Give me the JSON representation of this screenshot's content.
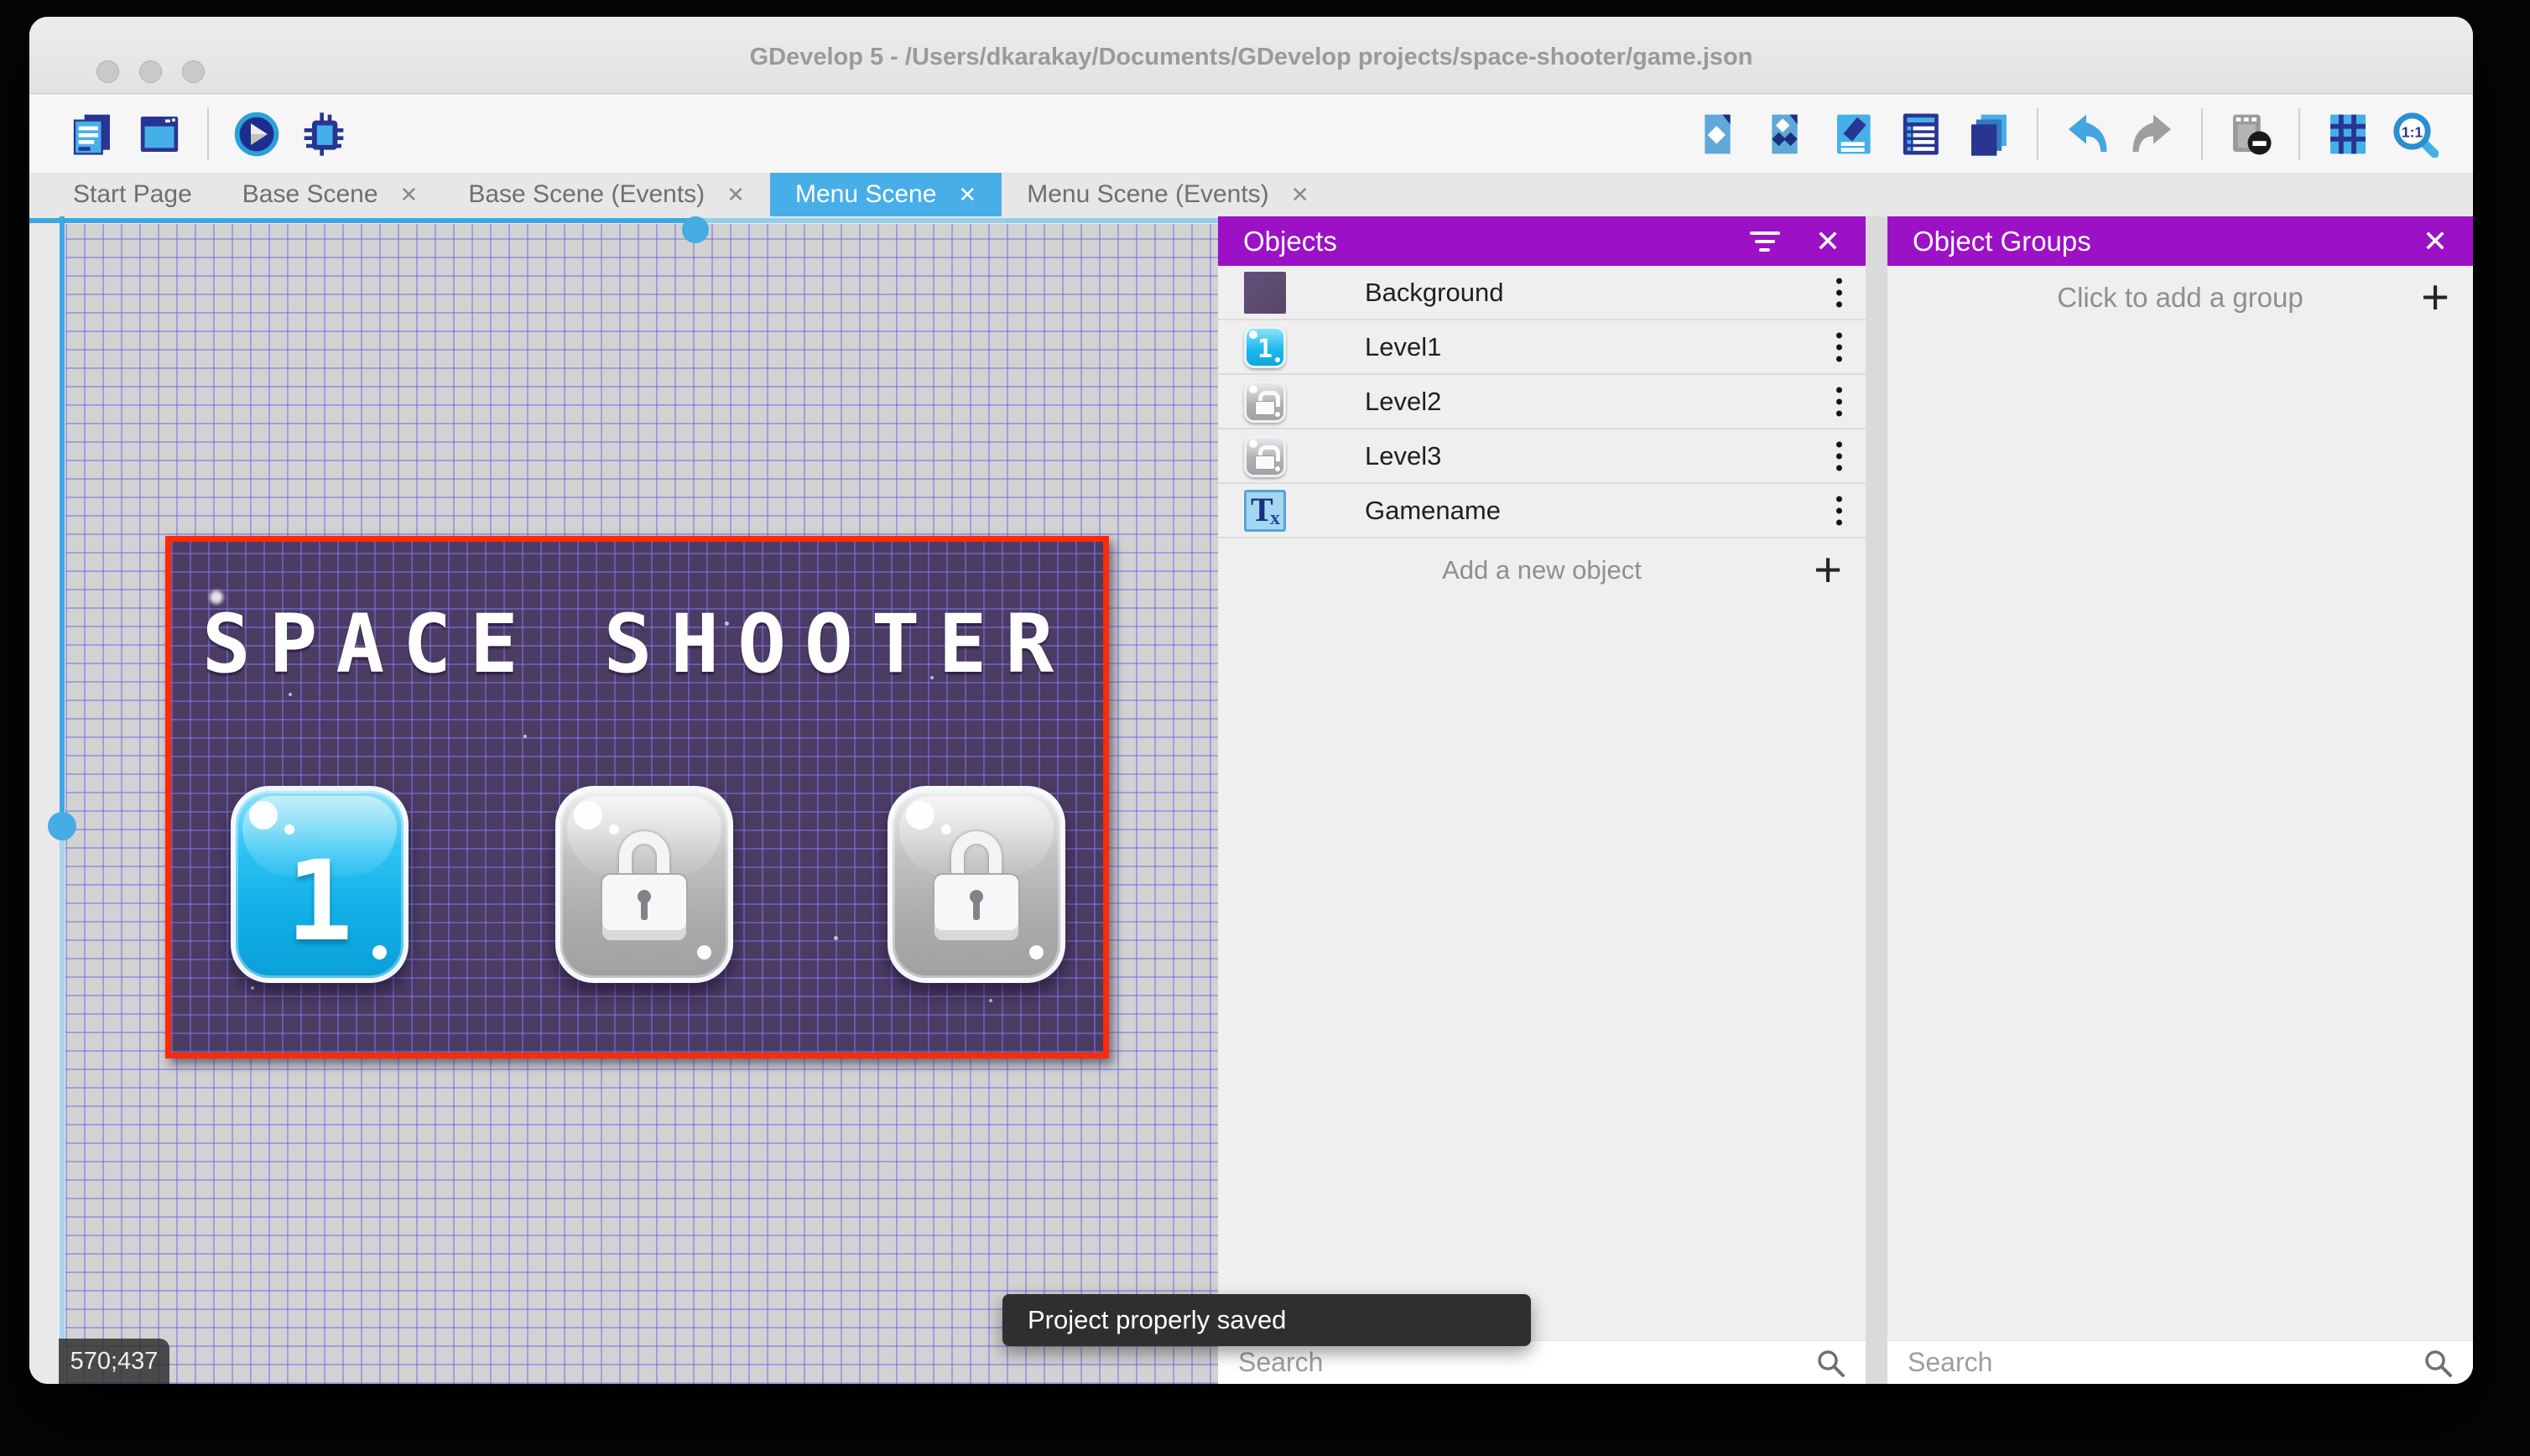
{
  "window": {
    "title": "GDevelop 5 - /Users/dkarakay/Documents/GDevelop projects/space-shooter/game.json"
  },
  "tabs": [
    {
      "label": "Start Page",
      "closable": false,
      "active": false
    },
    {
      "label": "Base Scene",
      "closable": true,
      "active": false
    },
    {
      "label": "Base Scene (Events)",
      "closable": true,
      "active": false
    },
    {
      "label": "Menu Scene",
      "closable": true,
      "active": true
    },
    {
      "label": "Menu Scene (Events)",
      "closable": true,
      "active": false
    }
  ],
  "toolbar": {
    "left_icons": [
      "project-manager-icon",
      "preview-window-icon",
      "play-preview-icon",
      "debug-icon"
    ],
    "right_icons": [
      "objects-editor-icon",
      "object-groups-editor-icon",
      "properties-icon",
      "instances-list-icon",
      "layers-icon",
      "undo-icon",
      "redo-icon",
      "render-mask-icon",
      "grid-toggle-icon",
      "zoom-1-1-icon"
    ]
  },
  "canvas": {
    "coordinates": "570;437",
    "scene": {
      "title": "SPACE SHOOTER",
      "buttons": [
        {
          "label": "1",
          "state": "unlocked"
        },
        {
          "label": "",
          "state": "locked"
        },
        {
          "label": "",
          "state": "locked"
        }
      ]
    }
  },
  "objects_panel": {
    "title": "Objects",
    "items": [
      {
        "name": "Background",
        "icon": "background-thumbnail"
      },
      {
        "name": "Level1",
        "icon": "level1-button-thumbnail"
      },
      {
        "name": "Level2",
        "icon": "locked-button-thumbnail"
      },
      {
        "name": "Level3",
        "icon": "locked-button-thumbnail"
      },
      {
        "name": "Gamename",
        "icon": "text-object-thumbnail"
      }
    ],
    "add_label": "Add a new object",
    "search_placeholder": "Search"
  },
  "groups_panel": {
    "title": "Object Groups",
    "empty_label": "Click to add a group",
    "search_placeholder": "Search"
  },
  "toast": {
    "message": "Project properly saved"
  },
  "colors": {
    "panel_header_purple": "#9c10c6",
    "active_tab_blue": "#47aee8",
    "selection_red": "#fe2a05",
    "scene_background": "#4c3b63",
    "grid_line": "#6d67e1",
    "level1_button_blue": "#12b1e8",
    "locked_button_gray": "#aeacaf",
    "toast_background": "#2f2f2f"
  }
}
